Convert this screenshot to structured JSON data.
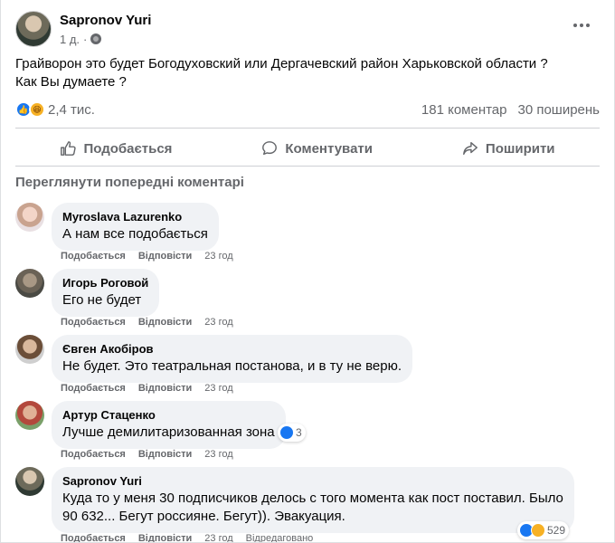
{
  "post": {
    "author": "Sapronov Yuri",
    "time": "1 д.",
    "separator": "·",
    "text_line1": "Грайворон это будет Богодуховский или Дергачевский район Харьковской области ?",
    "text_line2": "Как Вы думаете ?",
    "reaction_count": "2,4 тис.",
    "comments_count": "181 коментар",
    "shares_count": "30 поширень"
  },
  "actions": {
    "like": "Подобається",
    "comment": "Коментувати",
    "share": "Поширити"
  },
  "prev_comments_label": "Переглянути попередні коментарі",
  "comments": [
    {
      "name": "Myroslava Lazurenko",
      "text": "А нам все подобається",
      "like": "Подобається",
      "reply": "Відповісти",
      "time": "23 год"
    },
    {
      "name": "Игорь Роговой",
      "text": "Его не будет",
      "like": "Подобається",
      "reply": "Відповісти",
      "time": "23 год"
    },
    {
      "name": "Євген Акобіров",
      "text": "Не будет. Это театральная постанова, и в ту не верю.",
      "like": "Подобається",
      "reply": "Відповісти",
      "time": "23 год"
    },
    {
      "name": "Артур Стаценко",
      "text": "Лучше демилитаризованная зона",
      "like": "Подобається",
      "reply": "Відповісти",
      "time": "23 год",
      "reactions": "3"
    },
    {
      "name": "Sapronov Yuri",
      "text_line1": "Куда то у меня 30 подписчиков делось с того момента как пост поставил. Было",
      "text_line2": "90 632... Бегут россияне. Бегут)). Эвакуация.",
      "like": "Подобається",
      "reply": "Відповісти",
      "time": "23 год",
      "edited": "Відредаговано",
      "reactions": "529"
    }
  ],
  "colors": {
    "accent": "#1877f2",
    "haha": "#f7b125",
    "muted": "#65676b",
    "bubble": "#f0f2f5"
  }
}
